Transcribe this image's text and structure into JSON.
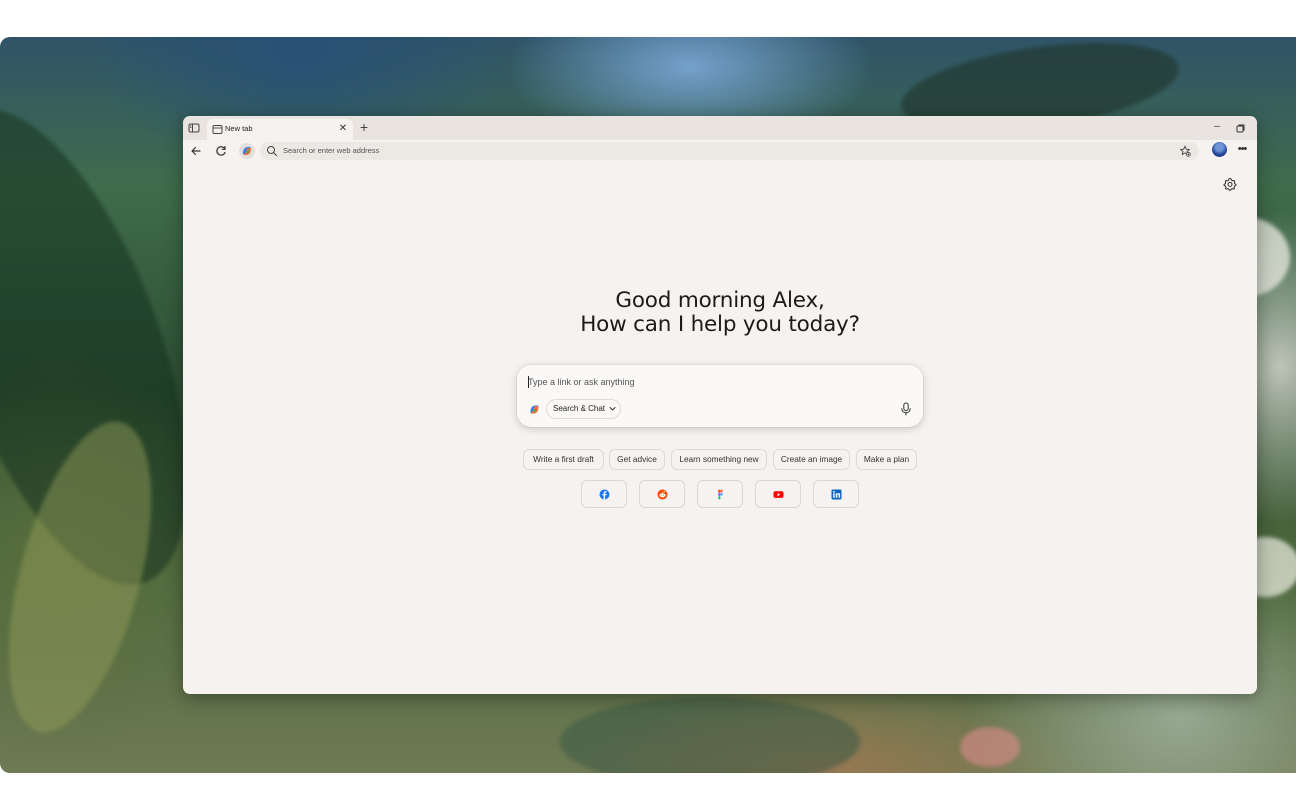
{
  "tab": {
    "title": "New tab"
  },
  "addressbar": {
    "placeholder": "Search or enter web address"
  },
  "greeting": {
    "line1": "Good morning Alex,",
    "line2": "How can I help you today?"
  },
  "chat": {
    "placeholder": "Type a link or ask anything",
    "mode_label": "Search & Chat"
  },
  "suggestions": [
    "Write a first draft",
    "Get advice",
    "Learn something new",
    "Create an image",
    "Make a plan"
  ],
  "shortcuts": [
    {
      "name": "facebook",
      "icon": "facebook-icon",
      "color": "#1877f2"
    },
    {
      "name": "reddit",
      "icon": "reddit-icon",
      "color": "#ff4500"
    },
    {
      "name": "figma",
      "icon": "figma-icon",
      "color": "#a259ff"
    },
    {
      "name": "youtube",
      "icon": "youtube-icon",
      "color": "#ff0000"
    },
    {
      "name": "linkedin",
      "icon": "linkedin-icon",
      "color": "#0a66c2"
    }
  ],
  "colors": {
    "page_bg": "#f6f2ef",
    "tabbar_bg": "#e9e4e0",
    "text": "#1b1b1b"
  }
}
